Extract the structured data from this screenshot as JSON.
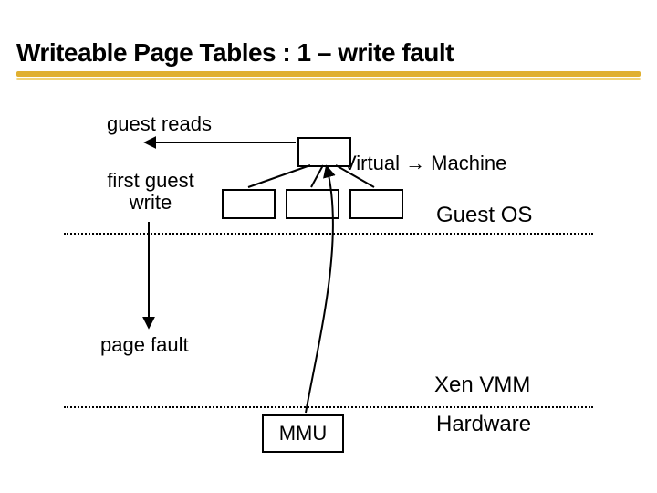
{
  "title": "Writeable Page Tables : 1 – write fault",
  "labels": {
    "guest_reads": "guest reads",
    "first_guest_write_l1": "first guest",
    "first_guest_write_l2": "write",
    "virtual_machine": "Virtual → Machine",
    "page_fault": "page fault",
    "mmu": "MMU"
  },
  "zones": {
    "guest_os": "Guest OS",
    "xen_vmm": "Xen VMM",
    "hardware": "Hardware"
  }
}
